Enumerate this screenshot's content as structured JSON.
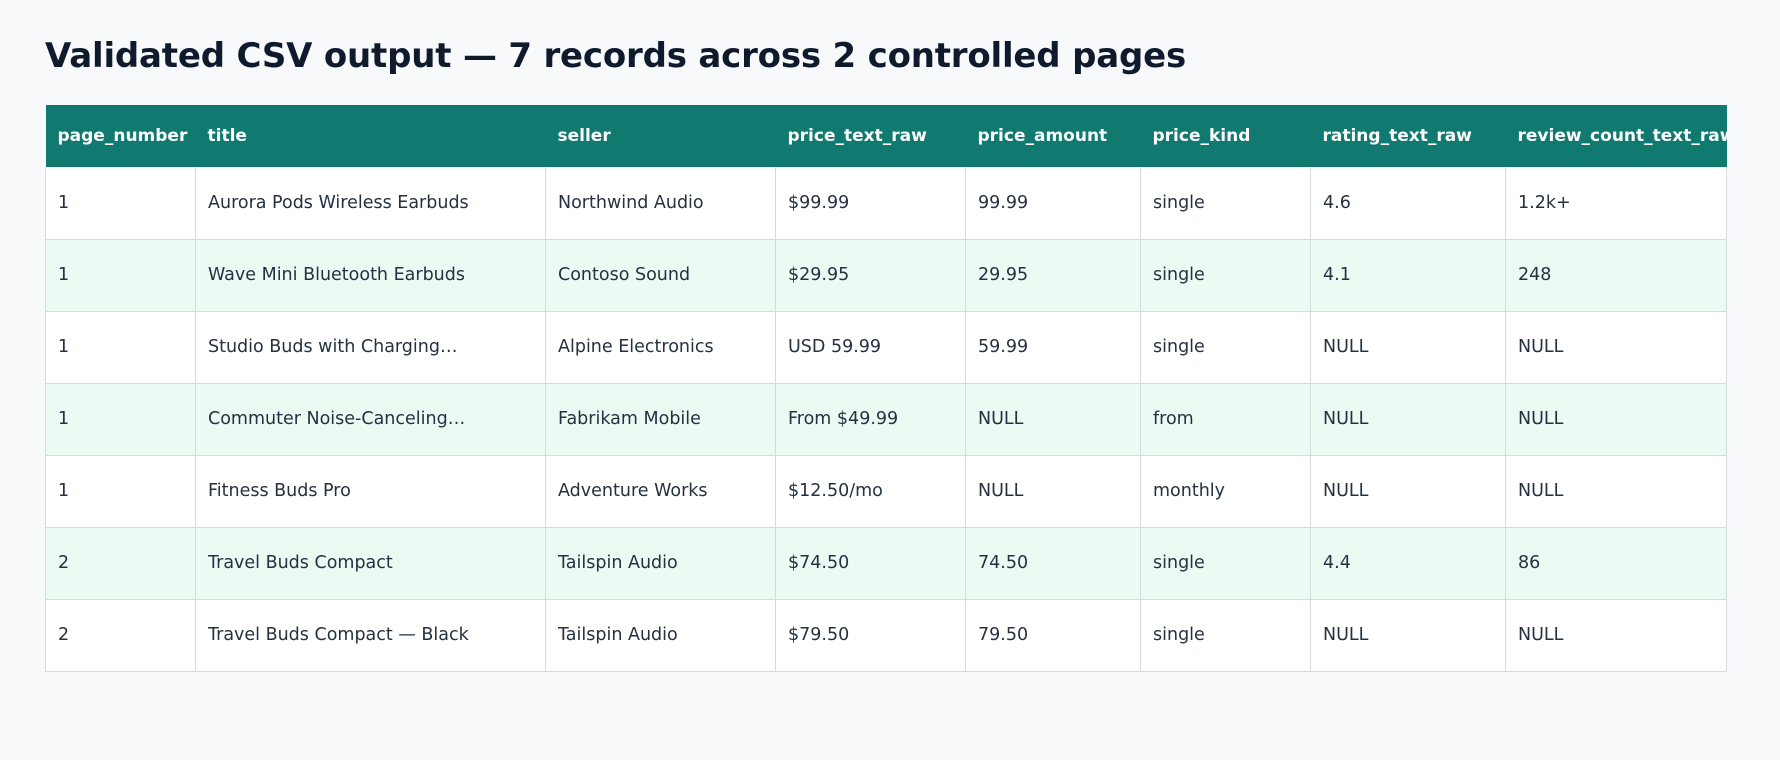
{
  "title": "Validated CSV output — 7 records across 2 controlled pages",
  "columns": [
    "page_number",
    "title",
    "seller",
    "price_text_raw",
    "price_amount",
    "price_kind",
    "rating_text_raw",
    "review_count_text_raw"
  ],
  "rows": [
    [
      "1",
      "Aurora Pods Wireless Earbuds",
      "Northwind Audio",
      "$99.99",
      "99.99",
      "single",
      "4.6",
      "1.2k+"
    ],
    [
      "1",
      "Wave Mini Bluetooth Earbuds",
      "Contoso Sound",
      "$29.95",
      "29.95",
      "single",
      "4.1",
      "248"
    ],
    [
      "1",
      "Studio Buds with Charging…",
      "Alpine Electronics",
      "USD 59.99",
      "59.99",
      "single",
      "NULL",
      "NULL"
    ],
    [
      "1",
      "Commuter Noise-Canceling…",
      "Fabrikam Mobile",
      "From $49.99",
      "NULL",
      "from",
      "NULL",
      "NULL"
    ],
    [
      "1",
      "Fitness Buds Pro",
      "Adventure Works",
      "$12.50/mo",
      "NULL",
      "monthly",
      "NULL",
      "NULL"
    ],
    [
      "2",
      "Travel Buds Compact",
      "Tailspin Audio",
      "$74.50",
      "74.50",
      "single",
      "4.4",
      "86"
    ],
    [
      "2",
      "Travel Buds Compact — Black",
      "Tailspin Audio",
      "$79.50",
      "79.50",
      "single",
      "NULL",
      "NULL"
    ]
  ]
}
